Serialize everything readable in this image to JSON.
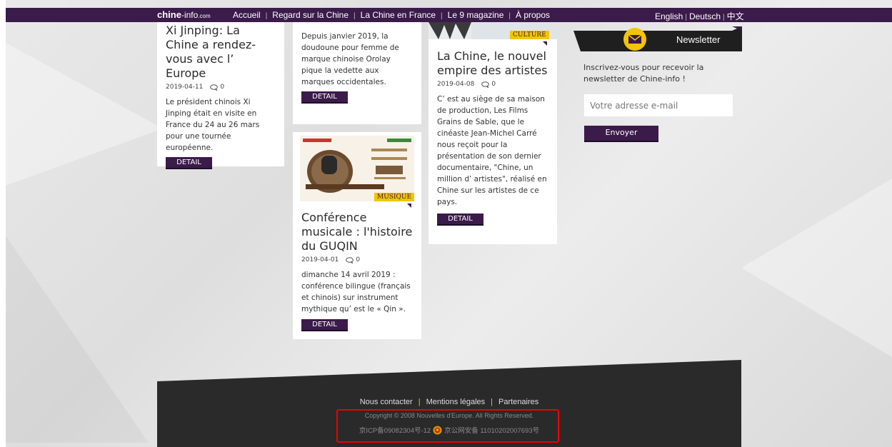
{
  "header": {
    "logo_main": "chine",
    "logo_dom": "-info",
    "logo_com": ".com",
    "nav": [
      "Accueil",
      "Regard sur la Chine",
      "La Chine en France",
      "Le 9 magazine",
      "À propos"
    ],
    "languages": [
      "English",
      "Deutsch",
      "中文"
    ]
  },
  "articles": [
    {
      "title": "Xi Jinping: La Chine a rendez-vous avec l’ Europe",
      "date": "2019-04-11",
      "comments": "0",
      "excerpt": "Le président chinois Xi Jinping était en visite en France du 24 au 26 mars pour une tournée européenne.",
      "button": "DETAIL"
    },
    {
      "excerpt": "Depuis janvier 2019, la doudoune pour femme de marque chinoise Orolay pique la vedette aux marques occidentales.",
      "button": "DETAIL"
    },
    {
      "tag": "MUSIQUE",
      "title": "Conférence musicale : l'histoire du GUQIN",
      "date": "2019-04-01",
      "comments": "0",
      "excerpt": "dimanche 14 avril 2019 : conférence bilingue (français et chinois) sur instrument mythique qu’ est le « Qin ».",
      "button": "DETAIL"
    },
    {
      "tag": "CULTURE",
      "title": "La Chine, le nouvel empire des artistes",
      "date": "2019-04-08",
      "comments": "0",
      "excerpt": "C’ est au siège de sa maison de production, Les Films Grains de Sable, que le cinéaste Jean-Michel Carré nous reçoit pour la présentation de son dernier documentaire, \"Chine, un million d’ artistes\", réalisé en Chine sur les artistes de ce pays.",
      "button": "DETAIL"
    }
  ],
  "newsletter": {
    "title": "Newsletter",
    "description": "Inscrivez-vous pour recevoir la newsletter de Chine-info !",
    "placeholder": "Votre adresse e-mail",
    "button": "Envoyer"
  },
  "footer": {
    "links": [
      "Nous contacter",
      "Mentions légales",
      "Partenaires"
    ],
    "copyright": "Copyright © 2008 Nouvelles d'Europe. All Rights Reserved.",
    "icp": "京ICP备09082304号-12",
    "police": "京公网安备 11010202007693号"
  },
  "colors": {
    "brand_purple": "#3b1b4a",
    "tag_yellow": "#f2c500",
    "footer_dark": "#2a2a2a",
    "highlight_red": "#ee0000"
  }
}
